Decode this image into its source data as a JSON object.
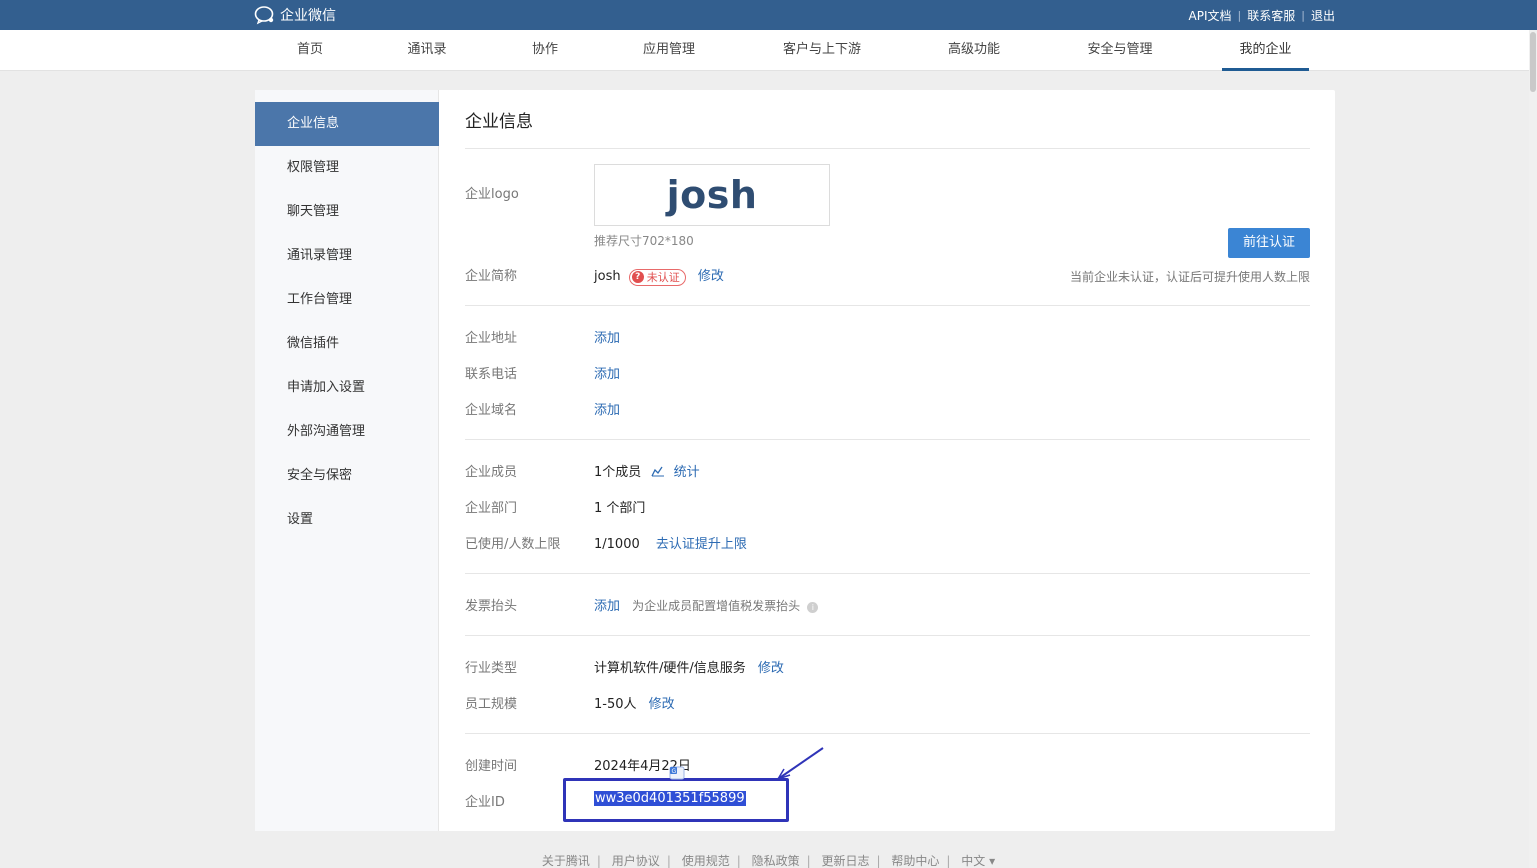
{
  "topbar": {
    "brand": "企业微信",
    "links": [
      "API文档",
      "联系客服",
      "退出"
    ],
    "bg_color": "#335f8f"
  },
  "nav": {
    "items": [
      "首页",
      "通讯录",
      "协作",
      "应用管理",
      "客户与上下游",
      "高级功能",
      "安全与管理",
      "我的企业"
    ],
    "active": "我的企业"
  },
  "sidebar": {
    "items": [
      "企业信息",
      "权限管理",
      "聊天管理",
      "通讯录管理",
      "工作台管理",
      "微信插件",
      "申请加入设置",
      "外部沟通管理",
      "安全与保密",
      "设置"
    ],
    "active": "企业信息"
  },
  "page": {
    "title": "企业信息",
    "logo_label": "企业logo",
    "logo_text": "josh",
    "logo_hint": "推荐尺寸702*180",
    "verify_button": "前往认证",
    "verify_note": "当前企业未认证，认证后可提升使用人数上限",
    "short_name_label": "企业简称",
    "short_name": "josh",
    "unverified_badge": "未认证",
    "edit": "修改",
    "address_label": "企业地址",
    "phone_label": "联系电话",
    "domain_label": "企业域名",
    "add": "添加",
    "members_label": "企业成员",
    "members_value": "1个成员",
    "stats_link": "统计",
    "departments_label": "企业部门",
    "departments_value": "1 个部门",
    "usage_label": "已使用/人数上限",
    "usage_value": "1/1000",
    "usage_link": "去认证提升上限",
    "invoice_label": "发票抬头",
    "invoice_note": "为企业成员配置增值税发票抬头",
    "industry_label": "行业类型",
    "industry_value": "计算机软件/硬件/信息服务",
    "scale_label": "员工规模",
    "scale_value": "1-50人",
    "created_label": "创建时间",
    "created_value": "2024年4月22日",
    "corp_id_label": "企业ID",
    "corp_id_value": "ww3e0d401351f55899"
  },
  "footer": {
    "links": [
      "关于腾讯",
      "用户协议",
      "使用规范",
      "隐私政策",
      "更新日志",
      "帮助中心",
      "中文 ▾"
    ]
  },
  "colors": {
    "accent": "#3b85d4",
    "sidebar_active": "#4b76aa",
    "highlight": "#2f34b8"
  }
}
